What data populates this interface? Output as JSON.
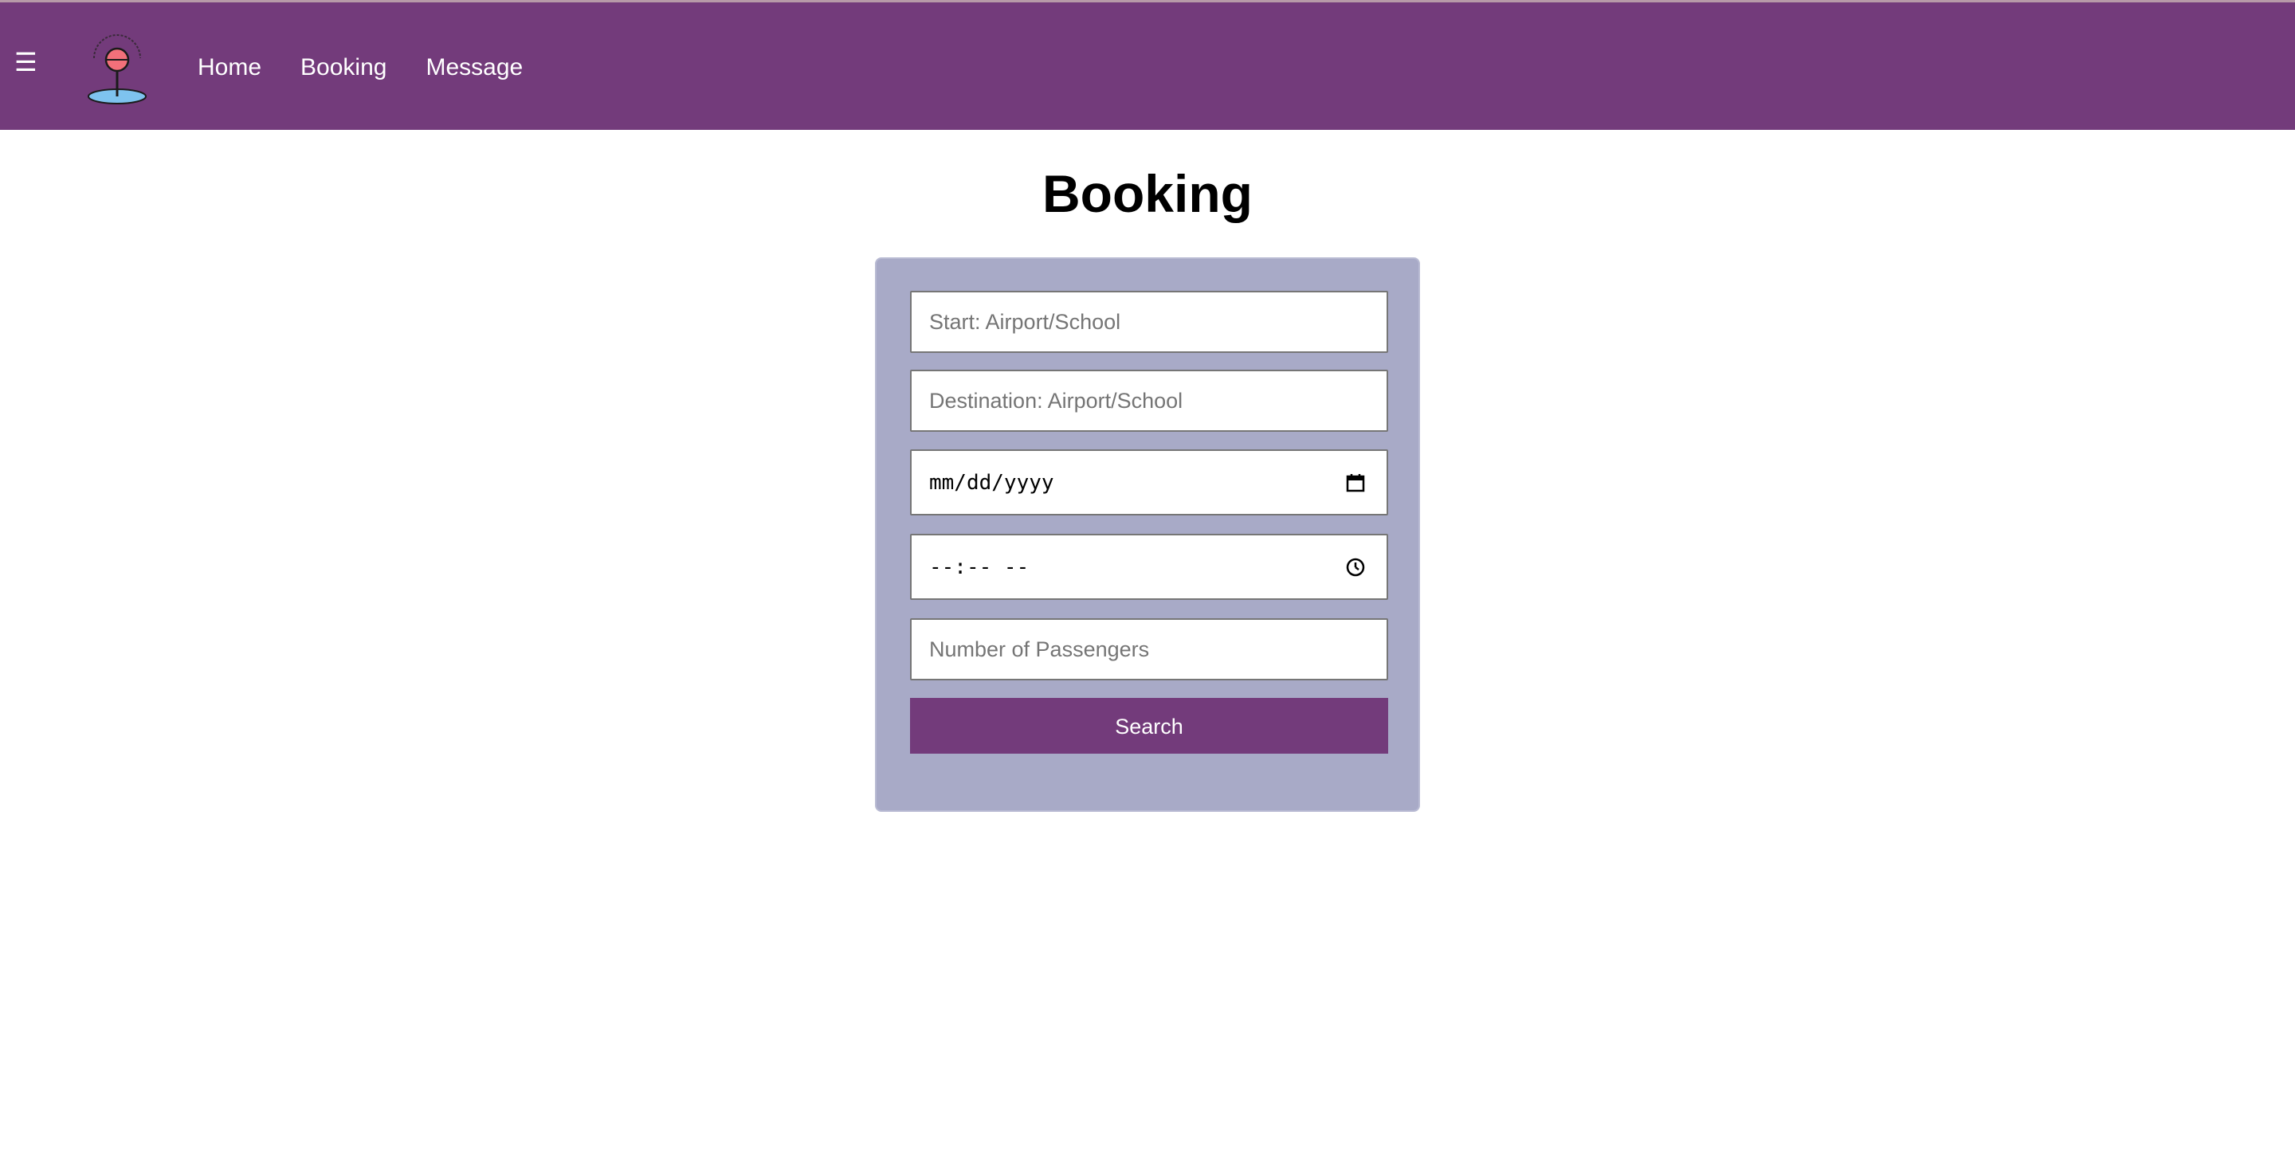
{
  "nav": {
    "menu_icon": "hamburger-icon",
    "menu_glyph": "☰",
    "logo_icon": "map-pin-logo-icon",
    "links": [
      {
        "label": "Home"
      },
      {
        "label": "Booking"
      },
      {
        "label": "Message"
      }
    ]
  },
  "page": {
    "title": "Booking"
  },
  "form": {
    "start_placeholder": "Start: Airport/School",
    "destination_placeholder": "Destination: Airport/School",
    "date_placeholder": "mm/dd/yyyy",
    "date_icon": "calendar-icon",
    "time_placeholder": "--:-- --",
    "time_icon": "clock-icon",
    "passengers_placeholder": "Number of Passengers",
    "search_label": "Search"
  },
  "colors": {
    "header": "#733b7b",
    "card": "#a8aac7",
    "button": "#733b7b"
  }
}
